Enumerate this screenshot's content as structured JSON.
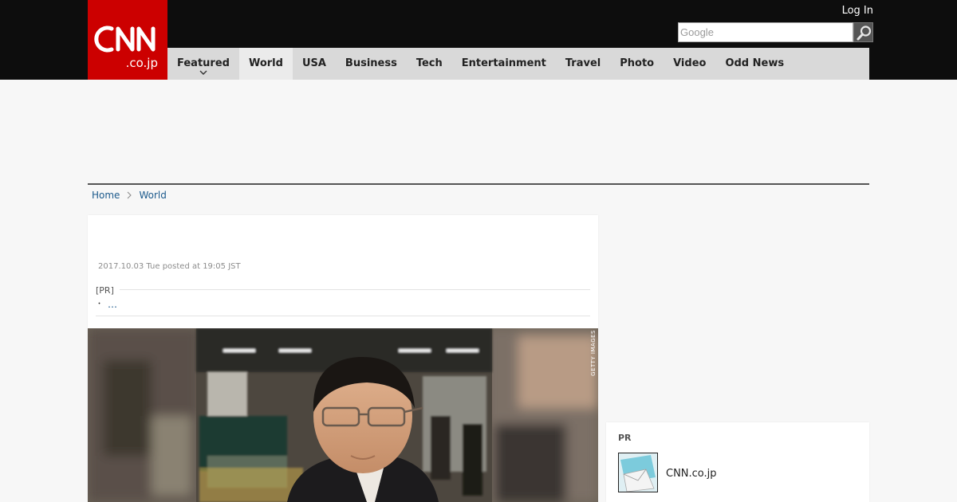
{
  "header": {
    "logo_text": "CNN",
    "logo_sub": ".co.jp",
    "login_label": "Log In",
    "search_placeholder": "Google"
  },
  "nav": {
    "items": [
      {
        "label": "Featured"
      },
      {
        "label": "World"
      },
      {
        "label": "USA"
      },
      {
        "label": "Business"
      },
      {
        "label": "Tech"
      },
      {
        "label": "Entertainment"
      },
      {
        "label": "Travel"
      },
      {
        "label": "Photo"
      },
      {
        "label": "Video"
      },
      {
        "label": "Odd News"
      }
    ],
    "active_item": "World"
  },
  "breadcrumb": {
    "home": "Home",
    "section": "World"
  },
  "article": {
    "timestamp": "2017.10.03 Tue posted at 19:05 JST",
    "pr_label": "[PR]",
    "pr_bullet": "・",
    "pr_link": "…",
    "photo_credit": "GETTY IMAGES"
  },
  "sidebar": {
    "pr_label": "PR",
    "pr_item_text": "CNN.co.jp"
  },
  "colors": {
    "brand_red": "#cc0000",
    "topbar": "#0d0d0d",
    "nav_bg": "#d9d9d9",
    "link": "#1c5a8c"
  },
  "icons": {
    "search": "magnifier-icon",
    "nav_caret": "chevron-down-icon",
    "breadcrumb_sep": "chevron-right-icon"
  }
}
